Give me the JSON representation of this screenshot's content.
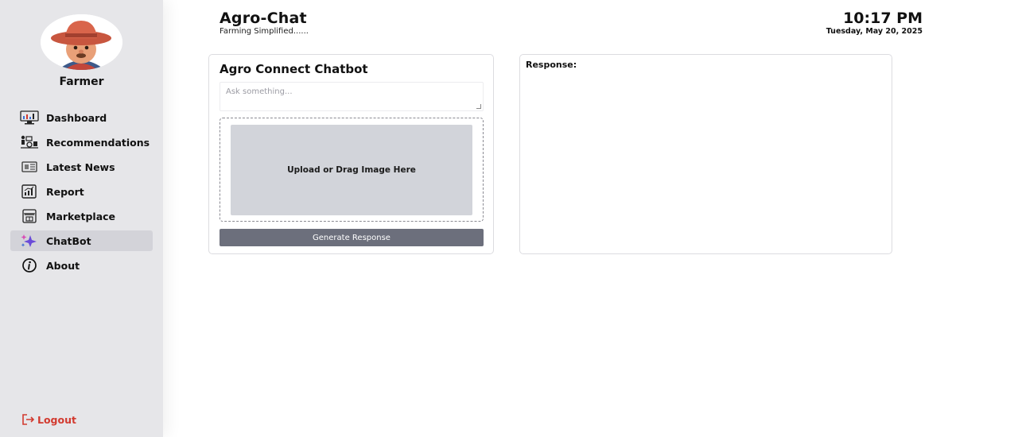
{
  "sidebar": {
    "profile_name": "Farmer",
    "items": [
      {
        "label": "Dashboard",
        "icon": "dashboard-monitor-icon"
      },
      {
        "label": "Recommendations",
        "icon": "recommendations-icon"
      },
      {
        "label": "Latest News",
        "icon": "newspaper-icon"
      },
      {
        "label": "Report",
        "icon": "report-chart-icon"
      },
      {
        "label": "Marketplace",
        "icon": "marketplace-shop-icon"
      },
      {
        "label": "ChatBot",
        "icon": "sparkle-icon",
        "active": true
      },
      {
        "label": "About",
        "icon": "info-icon"
      }
    ],
    "logout_label": "Logout",
    "logout_color": "#d23a2f"
  },
  "header": {
    "title": "Agro-Chat",
    "subtitle": "Farming Simplified......",
    "time": "10:17 PM",
    "date": "Tuesday, May 20, 2025"
  },
  "chat": {
    "title": "Agro Connect Chatbot",
    "prompt_placeholder": "Ask something...",
    "upload_label": "Upload or Drag Image Here",
    "button_label": "Generate Response",
    "button_color": "#6c6f7c"
  },
  "response": {
    "label": "Response:"
  }
}
